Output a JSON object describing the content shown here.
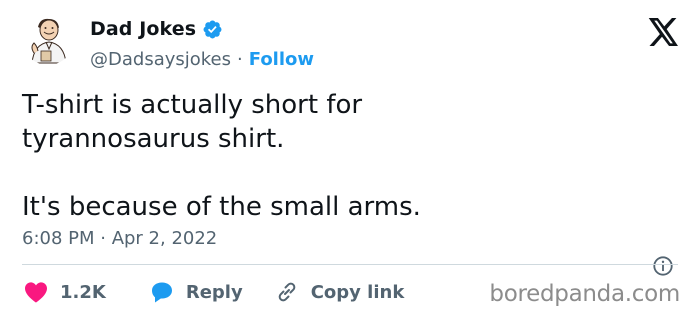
{
  "author": {
    "name": "Dad Jokes",
    "handle": "@Dadsaysjokes",
    "separator": "·",
    "follow_label": "Follow",
    "verified": true,
    "avatar_icon": "cartoon-dad-avatar"
  },
  "platform_icon": "x-logo-icon",
  "tweet": {
    "text": "T-shirt is actually short for\ntyrannosaurus shirt.\n\nIt's because of the small arms.",
    "timestamp": "6:08 PM · Apr 2, 2022"
  },
  "actions": {
    "likes": "1.2K",
    "reply_label": "Reply",
    "copy_link_label": "Copy link"
  },
  "watermark": "boredpanda.com",
  "colors": {
    "accent": "#1d9bf0",
    "like": "#f91880",
    "text": "#0f1419",
    "muted": "#536471",
    "divider": "#cfd9de"
  }
}
